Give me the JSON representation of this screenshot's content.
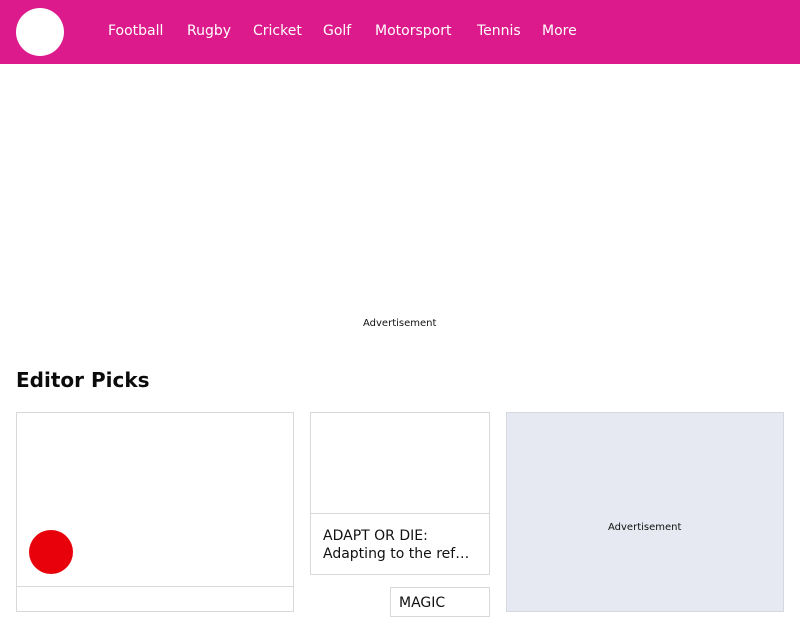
{
  "brand": {
    "accent": "#dc1a8b",
    "badge": "#e8000b",
    "ad_background": "#e6e9f1"
  },
  "header": {
    "logo": "site-logo",
    "nav": [
      "Football",
      "Rugby",
      "Cricket",
      "Golf",
      "Motorsport",
      "Tennis",
      "More"
    ]
  },
  "top_ad": {
    "label": "Advertisement"
  },
  "editor_picks": {
    "title": "Editor Picks",
    "cards": [
      {
        "title_line1": "",
        "title_line2": ""
      },
      {
        "title_line1": "ADAPT OR DIE:",
        "title_line2": "Adapting to the ref…"
      },
      {
        "title_line1": "MAGIC"
      }
    ],
    "side_ad": {
      "label": "Advertisement"
    }
  }
}
